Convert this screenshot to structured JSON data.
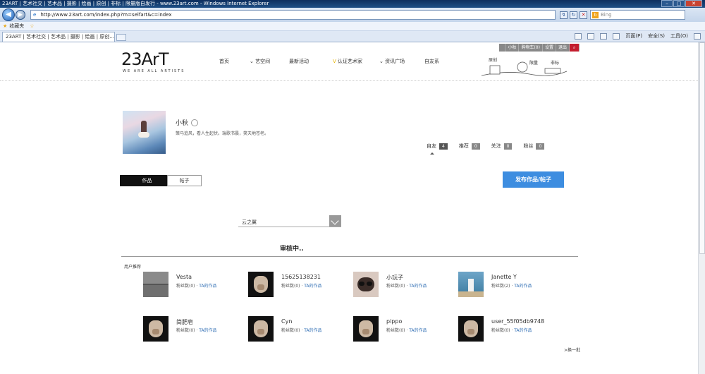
{
  "window": {
    "title": "23ART | 艺术社交 | 艺术品 | 摄影 | 绘画 | 原创 | 非标 | 限量版自发行 - www.23art.com - Windows Internet Explorer"
  },
  "browser": {
    "url": "http://www.23art.com/index.php?m=selfart&c=index",
    "search_engine": "Bing",
    "favorites_label": "收藏夹",
    "tab_label": "23ART | 艺术社交 | 艺术品 | 摄影 | 绘画 | 原创...",
    "commands": [
      "页面(P)",
      "安全(S)",
      "工具(O)"
    ]
  },
  "site": {
    "logo_text": "23ArT",
    "logo_tagline": "WE ARE ALL ARTISTS",
    "nav": [
      "首页",
      "艺空间",
      "最新活动",
      "认证艺术家",
      "资讯广场",
      "自友系"
    ],
    "user_bar": [
      "小秋",
      "购物车(0)",
      "设置",
      "退出"
    ],
    "header_art_words": [
      "原创",
      "限量",
      "非标"
    ]
  },
  "profile": {
    "name": "小秋",
    "bio": "策马追风，看人生起伏。瑞歌书晨，笑天地苍老。",
    "stats": [
      {
        "label": "自友",
        "value": "4"
      },
      {
        "label": "推荐",
        "value": "0"
      },
      {
        "label": "关注",
        "value": "0"
      },
      {
        "label": "粉丝",
        "value": "0"
      }
    ]
  },
  "tabs": {
    "works": "作品",
    "posts": "帖子"
  },
  "publish_button": "发布作品/帖子",
  "filter": {
    "selected": "云之翼"
  },
  "status_text": "审核中..",
  "recommend": {
    "title": "用户推荐",
    "more": ">换一批",
    "users": [
      {
        "name": "Vesta",
        "fans": "粉丝数(0)",
        "link": "TA的作品"
      },
      {
        "name": "15625138231",
        "fans": "粉丝数(0)",
        "link": "TA的作品"
      },
      {
        "name": "小玩子",
        "fans": "粉丝数(0)",
        "link": "TA的作品"
      },
      {
        "name": "Janette Y",
        "fans": "粉丝数(2)",
        "link": "TA的作品"
      },
      {
        "name": "简肥皂",
        "fans": "粉丝数(0)",
        "link": "TA的作品"
      },
      {
        "name": "Cyn",
        "fans": "粉丝数(0)",
        "link": "TA的作品"
      },
      {
        "name": "pippo",
        "fans": "粉丝数(0)",
        "link": "TA的作品"
      },
      {
        "name": "user_55f05db9748",
        "fans": "粉丝数(0)",
        "link": "TA的作品"
      }
    ]
  }
}
